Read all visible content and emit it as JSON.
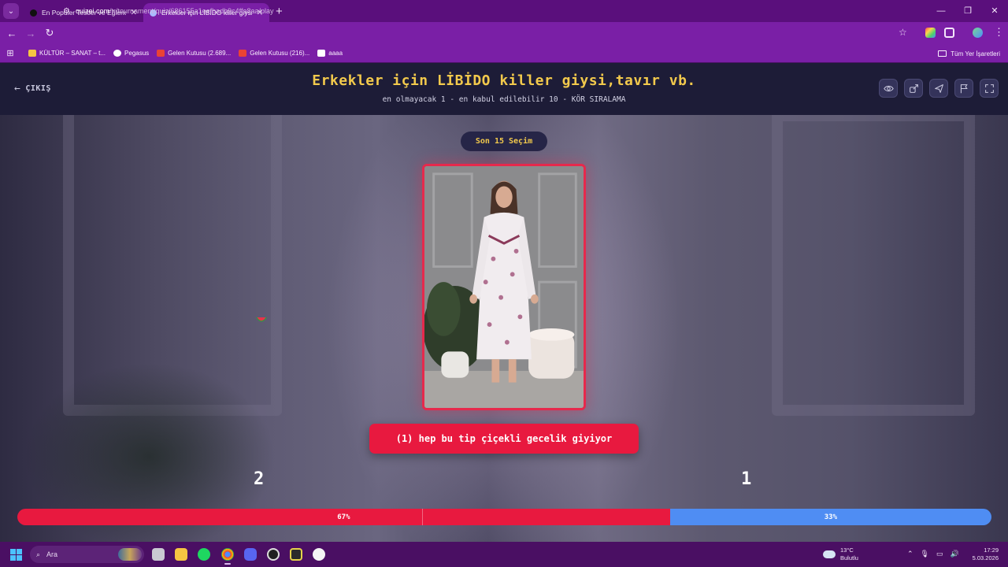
{
  "browser": {
    "tabs": [
      {
        "title": "En Popüler Testler ve Eğlenceli Q",
        "active": false
      },
      {
        "title": "Erkekler için LİBİDO killer giysi,t",
        "active": true
      }
    ],
    "new_tab": "+",
    "url_host": "quizei.com",
    "url_path": "/tr/tournament/quiz/686155a1eefbadb9c4ffa8aa/play",
    "bookmarks": [
      {
        "label": "KÜLTÜR – SANAT – t...",
        "icon": "folder-icon",
        "color": "#f5c542"
      },
      {
        "label": "Pegasus",
        "icon": "pegasus-icon",
        "color": "#ffffff"
      },
      {
        "label": "Gelen Kutusu (2.689...",
        "icon": "gmail-icon",
        "color": "#ea4335"
      },
      {
        "label": "Gelen Kutusu (216)...",
        "icon": "gmail-icon",
        "color": "#ea4335"
      },
      {
        "label": "aaaa",
        "icon": "bookmark-icon",
        "color": "#ffffff"
      }
    ],
    "all_bookmarks": "Tüm Yer İşaretleri"
  },
  "header": {
    "exit_label": "ÇIKIŞ",
    "title": "Erkekler için LİBİDO killer giysi,tavır vb.",
    "subtitle": "en olmayacak 1 - en kabul edilebilir 10 - KÖR SIRALAMA",
    "icons": [
      "eye-icon",
      "share-icon",
      "send-icon",
      "flag-icon",
      "fullscreen-icon"
    ]
  },
  "quiz": {
    "recent_badge": "Son 15 Seçim",
    "caption": "(1) hep bu tip çiçekli gecelik giyiyor",
    "left_rank": "2",
    "right_rank": "1",
    "vote_left_pct": "67%",
    "vote_right_pct": "33%",
    "vote_left_fraction": 0.67,
    "colors": {
      "accent_red": "#e8193f",
      "accent_blue": "#4f8df3",
      "title_yellow": "#f2c94c"
    }
  },
  "taskbar": {
    "search_placeholder": "Ara",
    "weather_temp": "13°C",
    "weather_desc": "Bulutlu",
    "time": "17:29",
    "date": "5.03.2026",
    "apps": [
      "file-explorer-icon",
      "folder-icon",
      "spotify-icon",
      "chrome-icon",
      "discord-icon",
      "obs-icon",
      "app-icon",
      "app-icon"
    ]
  }
}
